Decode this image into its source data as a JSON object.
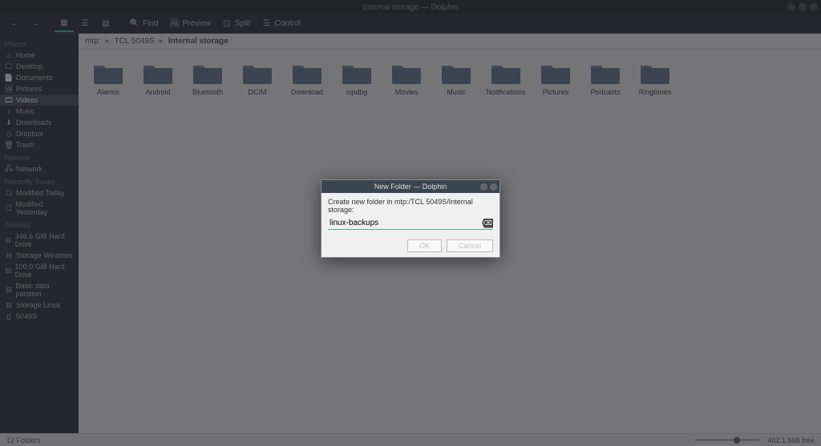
{
  "window": {
    "title": "Internal storage — Dolphin"
  },
  "toolbar": {
    "back": "◄",
    "forward": "►",
    "find_label": "Find",
    "preview_label": "Preview",
    "split_label": "Split",
    "control_label": "Control"
  },
  "sidebar": {
    "places": {
      "header": "Places",
      "items": [
        {
          "label": "Home"
        },
        {
          "label": "Desktop"
        },
        {
          "label": "Documents"
        },
        {
          "label": "Pictures"
        },
        {
          "label": "Videos"
        },
        {
          "label": "Music"
        },
        {
          "label": "Downloads"
        },
        {
          "label": "Dropbox"
        },
        {
          "label": "Trash"
        }
      ]
    },
    "remote": {
      "header": "Remote",
      "items": [
        {
          "label": "Network"
        }
      ]
    },
    "recent": {
      "header": "Recently Saved",
      "items": [
        {
          "label": "Modified Today"
        },
        {
          "label": "Modified Yesterday"
        }
      ]
    },
    "devices": {
      "header": "Devices",
      "items": [
        {
          "label": "346.6 GiB Hard Drive"
        },
        {
          "label": "Storage Windows"
        },
        {
          "label": "100.0 GiB Hard Drive"
        },
        {
          "label": "Basic data partition"
        },
        {
          "label": "Storage Linux"
        },
        {
          "label": "5049S"
        }
      ]
    }
  },
  "breadcrumb": {
    "parts": [
      "mtp:",
      "TCL 5049S",
      "Internal storage"
    ]
  },
  "folders": [
    {
      "name": "Alarms"
    },
    {
      "name": "Android"
    },
    {
      "name": "Bluetooth"
    },
    {
      "name": "DCIM"
    },
    {
      "name": "Download"
    },
    {
      "name": "ispdbg"
    },
    {
      "name": "Movies"
    },
    {
      "name": "Music"
    },
    {
      "name": "Notifications"
    },
    {
      "name": "Pictures"
    },
    {
      "name": "Podcasts"
    },
    {
      "name": "Ringtones"
    }
  ],
  "statusbar": {
    "count": "12 Folders",
    "free": "402.1 MiB free"
  },
  "dialog": {
    "title": "New Folder — Dolphin",
    "prompt": "Create new folder in mtp:/TCL 5049S/Internal storage:",
    "value": "linux-backups",
    "ok": "OK",
    "cancel": "Cancel"
  }
}
